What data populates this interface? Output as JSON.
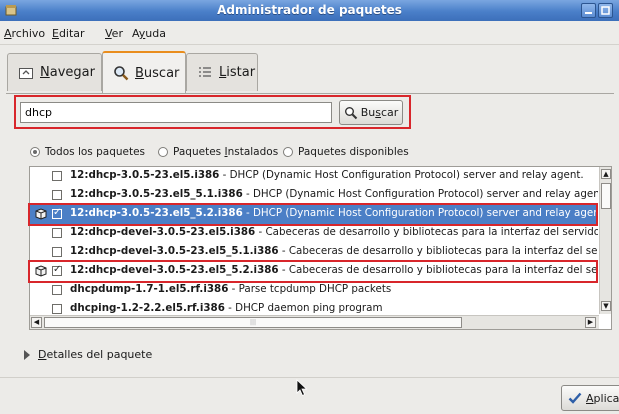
{
  "window": {
    "title": "Administrador de paquetes"
  },
  "menu": [
    {
      "pre": "",
      "u": "A",
      "post": "rchivo"
    },
    {
      "pre": "",
      "u": "E",
      "post": "ditar"
    },
    {
      "pre": "",
      "u": "V",
      "post": "er"
    },
    {
      "pre": "A",
      "u": "y",
      "post": "uda"
    }
  ],
  "tabs": [
    {
      "pre": "",
      "u": "N",
      "post": "avegar",
      "icon": "browse-icon",
      "active": false
    },
    {
      "pre": "",
      "u": "B",
      "post": "uscar",
      "icon": "magnifier-icon",
      "active": true
    },
    {
      "pre": "",
      "u": "L",
      "post": "istar",
      "icon": "list-icon",
      "active": false
    }
  ],
  "search": {
    "value": "dhcp",
    "button_pre": "Bu",
    "button_u": "s",
    "button_post": "car"
  },
  "filters": {
    "options": [
      {
        "pre": "Todos los paquetes",
        "u": "",
        "post": "",
        "selected": true
      },
      {
        "pre": "Paquetes ",
        "u": "I",
        "post": "nstalados",
        "selected": false
      },
      {
        "pre": "Paquetes disponibles",
        "u": "",
        "post": "",
        "selected": false
      }
    ]
  },
  "packages": [
    {
      "name": "12:dhcp-3.0.5-23.el5.i386",
      "desc": " - DHCP (Dynamic Host Configuration Protocol) server and relay agent.",
      "checked": false,
      "installed": false,
      "selected": false,
      "highlighted": false
    },
    {
      "name": "12:dhcp-3.0.5-23.el5_5.1.i386",
      "desc": " - DHCP (Dynamic Host Configuration Protocol) server and relay agent.",
      "checked": false,
      "installed": false,
      "selected": false,
      "highlighted": false
    },
    {
      "name": "12:dhcp-3.0.5-23.el5_5.2.i386",
      "desc": " - DHCP (Dynamic Host Configuration Protocol) server and relay agent.",
      "checked": true,
      "installed": true,
      "selected": true,
      "highlighted": true
    },
    {
      "name": "12:dhcp-devel-3.0.5-23.el5.i386",
      "desc": " - Cabeceras de desarrollo y bibliotecas para la interfaz del servidor D",
      "checked": false,
      "installed": false,
      "selected": false,
      "highlighted": false
    },
    {
      "name": "12:dhcp-devel-3.0.5-23.el5_5.1.i386",
      "desc": " - Cabeceras de desarrollo y bibliotecas para la interfaz del servi",
      "checked": false,
      "installed": false,
      "selected": false,
      "highlighted": false
    },
    {
      "name": "12:dhcp-devel-3.0.5-23.el5_5.2.i386",
      "desc": " - Cabeceras de desarrollo y bibliotecas para la interfaz del servi",
      "checked": true,
      "installed": true,
      "selected": false,
      "highlighted": true
    },
    {
      "name": "dhcpdump-1.7-1.el5.rf.i386",
      "desc": " - Parse tcpdump DHCP packets",
      "checked": false,
      "installed": false,
      "selected": false,
      "highlighted": false
    },
    {
      "name": "dhcping-1.2-2.2.el5.rf.i386",
      "desc": " - DHCP daemon ping program",
      "checked": false,
      "installed": false,
      "selected": false,
      "highlighted": false
    }
  ],
  "details": {
    "pre": "",
    "u": "D",
    "post": "etalles del paquete"
  },
  "apply": {
    "pre": "",
    "u": "A",
    "post": "plicar"
  },
  "colors": {
    "selection": "#4b7fc6",
    "highlight_border": "#d8262b",
    "tab_accent": "#e98d1d",
    "titlebar": "#4a7fc9"
  }
}
